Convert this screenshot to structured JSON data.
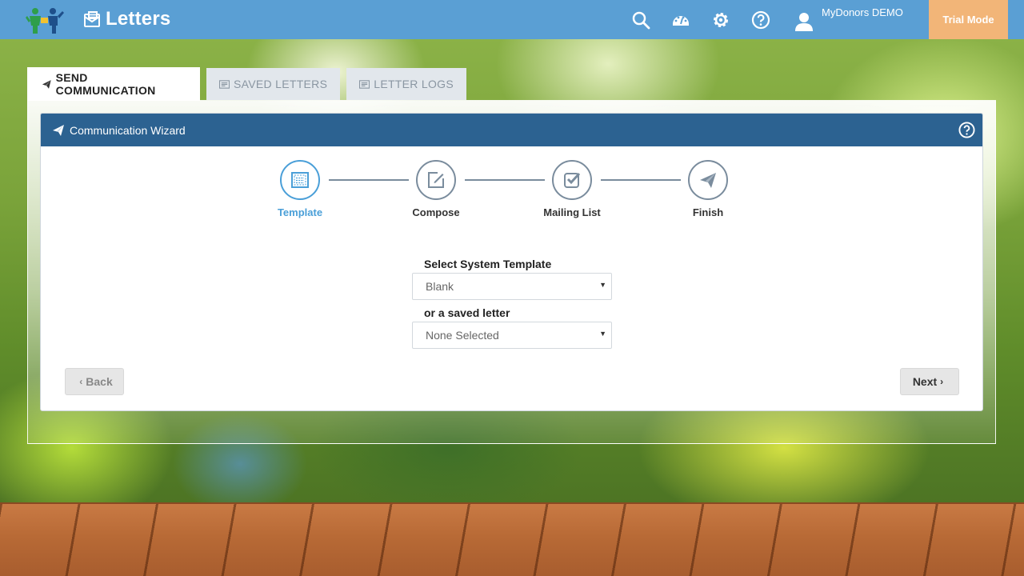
{
  "app": {
    "title": "Letters",
    "user_name": "MyDonors DEMO",
    "trial_label": "Trial Mode",
    "accent": "#5a9fd4",
    "trial_color": "#f2b578"
  },
  "top_icons": [
    "search-icon",
    "dashboard-icon",
    "gear-icon",
    "help-icon",
    "user-icon"
  ],
  "tabs": [
    {
      "label": "SEND COMMUNICATION",
      "icon": "paper-plane-icon",
      "active": true
    },
    {
      "label": "SAVED LETTERS",
      "icon": "letter-icon",
      "active": false
    },
    {
      "label": "LETTER LOGS",
      "icon": "letter-icon",
      "active": false
    }
  ],
  "wizard": {
    "title": "Communication Wizard",
    "header_color": "#2c6291",
    "steps": [
      {
        "label": "Template",
        "icon": "template-icon",
        "active": true
      },
      {
        "label": "Compose",
        "icon": "edit-icon",
        "active": false
      },
      {
        "label": "Mailing List",
        "icon": "checkbox-icon",
        "active": false
      },
      {
        "label": "Finish",
        "icon": "paper-plane-icon",
        "active": false
      }
    ],
    "system_template_label": "Select System Template",
    "system_template_value": "Blank",
    "saved_letter_label": "or a saved letter",
    "saved_letter_value": "None Selected",
    "back_label": "Back",
    "next_label": "Next"
  }
}
